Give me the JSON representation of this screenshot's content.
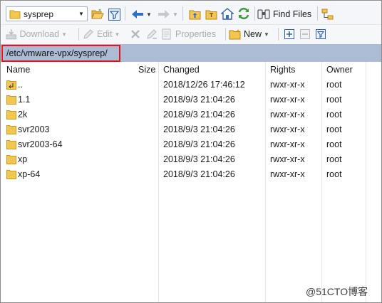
{
  "location": {
    "value": "sysprep"
  },
  "toolbar": {
    "find_files_label": "Find Files",
    "download_label": "Download",
    "edit_label": "Edit",
    "properties_label": "Properties",
    "new_label": "New"
  },
  "path": {
    "value": "/etc/vmware-vpx/sysprep/"
  },
  "columns": {
    "name": "Name",
    "size": "Size",
    "changed": "Changed",
    "rights": "Rights",
    "owner": "Owner"
  },
  "rows": [
    {
      "name": "..",
      "changed": "2018/12/26 17:46:12",
      "rights": "rwxr-xr-x",
      "owner": "root",
      "icon": "parent-directory-icon"
    },
    {
      "name": "1.1",
      "changed": "2018/9/3 21:04:26",
      "rights": "rwxr-xr-x",
      "owner": "root",
      "icon": "folder-icon"
    },
    {
      "name": "2k",
      "changed": "2018/9/3 21:04:26",
      "rights": "rwxr-xr-x",
      "owner": "root",
      "icon": "folder-icon"
    },
    {
      "name": "svr2003",
      "changed": "2018/9/3 21:04:26",
      "rights": "rwxr-xr-x",
      "owner": "root",
      "icon": "folder-icon"
    },
    {
      "name": "svr2003-64",
      "changed": "2018/9/3 21:04:26",
      "rights": "rwxr-xr-x",
      "owner": "root",
      "icon": "folder-icon"
    },
    {
      "name": "xp",
      "changed": "2018/9/3 21:04:26",
      "rights": "rwxr-xr-x",
      "owner": "root",
      "icon": "folder-icon"
    },
    {
      "name": "xp-64",
      "changed": "2018/9/3 21:04:26",
      "rights": "rwxr-xr-x",
      "owner": "root",
      "icon": "folder-icon"
    }
  ],
  "watermark": "@51CTO博客",
  "colors": {
    "path_bar": "#abbcd4",
    "highlight_border": "#e8101c",
    "folder": "#f3c64f",
    "accent_blue": "#2f6fc6",
    "accent_green": "#3f9b3a"
  }
}
